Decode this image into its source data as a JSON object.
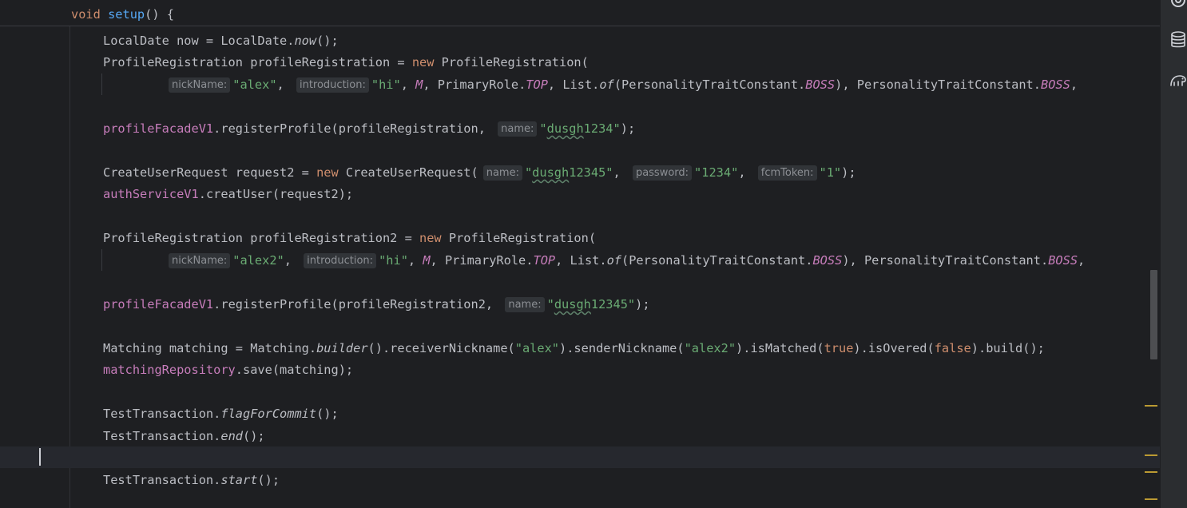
{
  "editor": {
    "sticky_header": {
      "kw_void": "void",
      "method": "setup",
      "rest": "() {"
    },
    "lines": {
      "l1": {
        "a": "LocalDate now = LocalDate.",
        "b": "now",
        "c": "();"
      },
      "l2": {
        "a": "ProfileRegistration profileRegistration = ",
        "kw": "new",
        "b": " ProfileRegistration("
      },
      "l3": {
        "hint1": "nickName:",
        "s1": "\"alex\"",
        "p1": ",",
        "hint2": "introduction:",
        "s2": "\"hi\"",
        "p2": ", ",
        "m": "M",
        "p3": ", PrimaryRole.",
        "top": "TOP",
        "p4": ", List.",
        "of": "of",
        "p5": "(PersonalityTraitConstant.",
        "boss1": "BOSS",
        "p6": "), PersonalityTraitConstant.",
        "boss2": "BOSS",
        "p7": ","
      },
      "l4": {
        "field": "profileFacadeV1",
        "a": ".registerProfile(profileRegistration,",
        "hint": "name:",
        "s_open": "\"",
        "s_word": "dusgh",
        "s_rest": "1234\"",
        "c": ");"
      },
      "l5": {
        "a": "CreateUserRequest request2 = ",
        "kw": "new",
        "b": " CreateUserRequest(",
        "hint1": "name:",
        "s1_open": "\"",
        "s1_word": "dusgh",
        "s1_rest": "12345\"",
        "p1": ",",
        "hint2": "password:",
        "s2": "\"1234\"",
        "p2": ",",
        "hint3": "fcmToken:",
        "s3": "\"1\"",
        "c": ");"
      },
      "l6": {
        "field": "authServiceV1",
        "a": ".creatUser(request2);"
      },
      "l7": {
        "a": "ProfileRegistration profileRegistration2 = ",
        "kw": "new",
        "b": " ProfileRegistration("
      },
      "l8": {
        "hint1": "nickName:",
        "s1": "\"alex2\"",
        "p1": ",",
        "hint2": "introduction:",
        "s2": "\"hi\"",
        "p2": ", ",
        "m": "M",
        "p3": ", PrimaryRole.",
        "top": "TOP",
        "p4": ", List.",
        "of": "of",
        "p5": "(PersonalityTraitConstant.",
        "boss1": "BOSS",
        "p6": "), PersonalityTraitConstant.",
        "boss2": "BOSS",
        "p7": ","
      },
      "l9": {
        "field": "profileFacadeV1",
        "a": ".registerProfile(profileRegistration2,",
        "hint": "name:",
        "s_open": "\"",
        "s_word": "dusgh",
        "s_rest": "12345\"",
        "c": ");"
      },
      "l10": {
        "a": "Matching matching = Matching.",
        "builder": "builder",
        "b": "().receiverNickname(",
        "s1": "\"alex\"",
        "c": ").senderNickname(",
        "s2": "\"alex2\"",
        "d": ").isMatched(",
        "t": "true",
        "e": ").isOvered(",
        "f": "false",
        "g": ").build();"
      },
      "l11": {
        "field": "matchingRepository",
        "a": ".save(matching);"
      },
      "l12": {
        "a": "TestTransaction.",
        "m": "flagForCommit",
        "b": "();"
      },
      "l13": {
        "a": "TestTransaction.",
        "m": "end",
        "b": "();"
      },
      "l14": {
        "a": "TestTransaction.",
        "m": "start",
        "b": "();"
      }
    }
  },
  "colors": {
    "background": "#1e1f22",
    "keyword": "#cf8e6d",
    "method_decl": "#56a8f5",
    "string": "#6aab73",
    "field": "#c77dbb",
    "default_text": "#bcbec4",
    "inlay_hint_bg": "#313438",
    "warning_marker": "#bb9a33"
  },
  "right_toolbar": {
    "icons": [
      "ai-assistant-icon",
      "database-icon",
      "gradle-elephant-icon"
    ]
  }
}
